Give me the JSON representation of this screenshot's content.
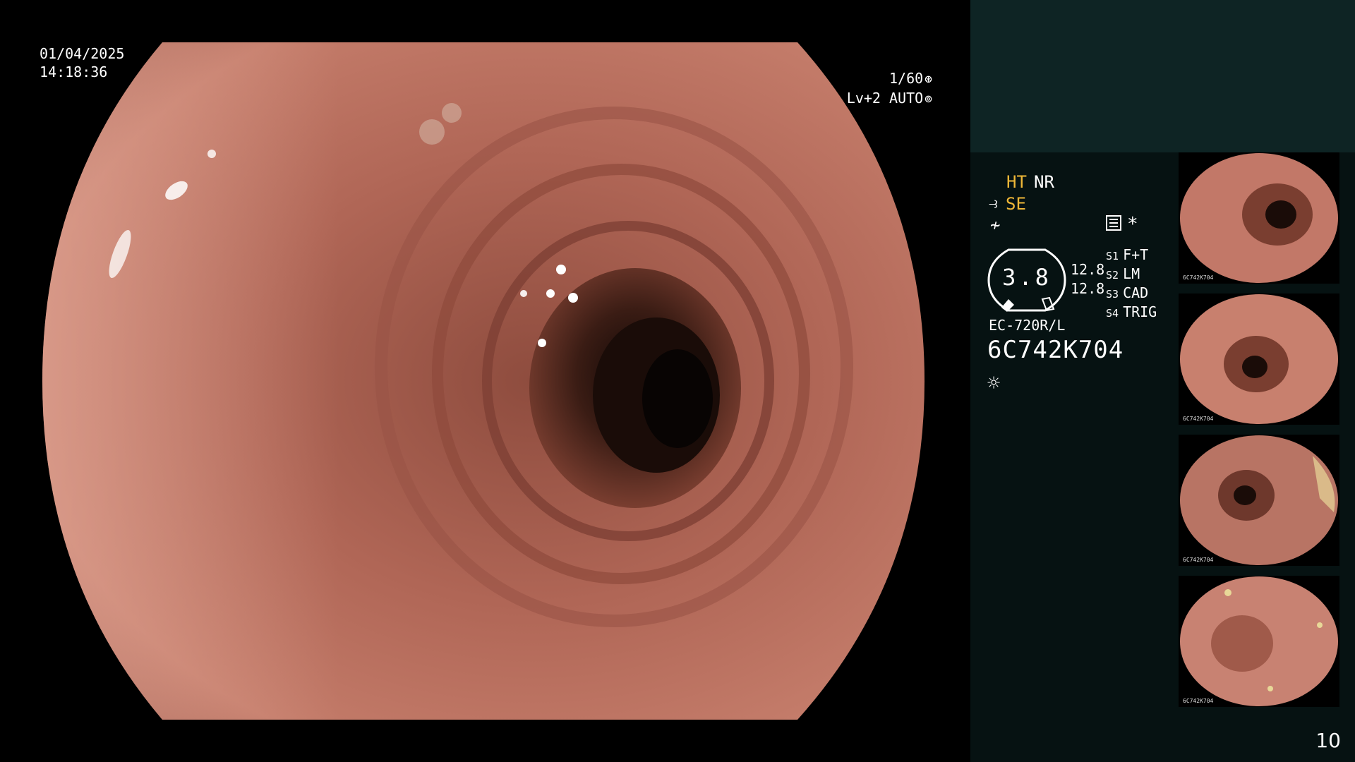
{
  "osd": {
    "date": "01/04/2025",
    "time": "14:18:36",
    "shutter": "1/60",
    "iris": "Lv+2 AUTO"
  },
  "panel": {
    "ht": "HT",
    "nr": "NR",
    "se": "SE",
    "star": "*",
    "gauge_value": "3.8",
    "gauge_side_1": "12.8",
    "gauge_side_2": "12.8",
    "slots": [
      {
        "key": "S1",
        "value": "F+T"
      },
      {
        "key": "S2",
        "value": "LM"
      },
      {
        "key": "S3",
        "value": "CAD"
      },
      {
        "key": "S4",
        "value": "TRIG"
      }
    ],
    "model": "EC-720R/L",
    "serial": "6C742K704"
  },
  "thumbnails": [
    {
      "caption": "6C742K704"
    },
    {
      "caption": "6C742K704"
    },
    {
      "caption": "6C742K704"
    },
    {
      "caption": "6C742K704"
    }
  ],
  "page_number": "10",
  "colors": {
    "highlight": "#f0b838",
    "panel_bg": "#061212",
    "panel_top_band": "#0e2424",
    "mucosa": "#b86a5a"
  },
  "icons": [
    "shutter-icon",
    "iris-icon",
    "se-icon",
    "f-icon",
    "menu-icon",
    "sun-icon"
  ]
}
